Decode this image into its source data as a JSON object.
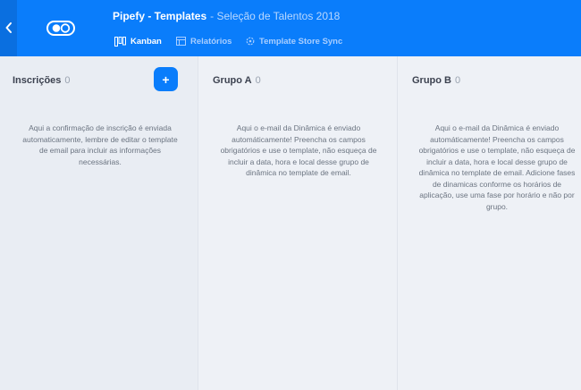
{
  "header": {
    "app_title": "Pipefy - Templates",
    "pipe_name": "- Seleção de Talentos 2018",
    "nav": [
      {
        "label": "Kanban",
        "icon": "kanban-icon",
        "active": true
      },
      {
        "label": "Relatórios",
        "icon": "reports-icon",
        "active": false
      },
      {
        "label": "Template Store Sync",
        "icon": "sync-icon",
        "active": false
      }
    ]
  },
  "colors": {
    "brand": "#0a7dfb",
    "back_strip": "#0a6fe0",
    "board_bg": "#eef1f6",
    "heading_text": "#3c4250",
    "body_text": "#6b7481"
  },
  "columns": [
    {
      "title": "Inscrições",
      "count": "0",
      "add_label": "+",
      "description": "Aqui a confirmação de inscrição é enviada automaticamente, lembre de editar o template de email para incluir as informações necessárias."
    },
    {
      "title": "Grupo A",
      "count": "0",
      "description": "Aqui o e-mail da Dinâmica é enviado automáticamente! Preencha os campos obrigatórios e use o template, não esqueça de incluir a data, hora e local desse grupo de dinâmica no template de email."
    },
    {
      "title": "Grupo B",
      "count": "0",
      "description": "Aqui o e-mail da Dinâmica é enviado automáticamente! Preencha os campos obrigatórios e use o template, não esqueça de incluir a data, hora e local desse grupo de dinâmica no template de email. Adicione fases de dinamicas conforme os horários de aplicação, use uma fase por horário e não por grupo."
    }
  ]
}
